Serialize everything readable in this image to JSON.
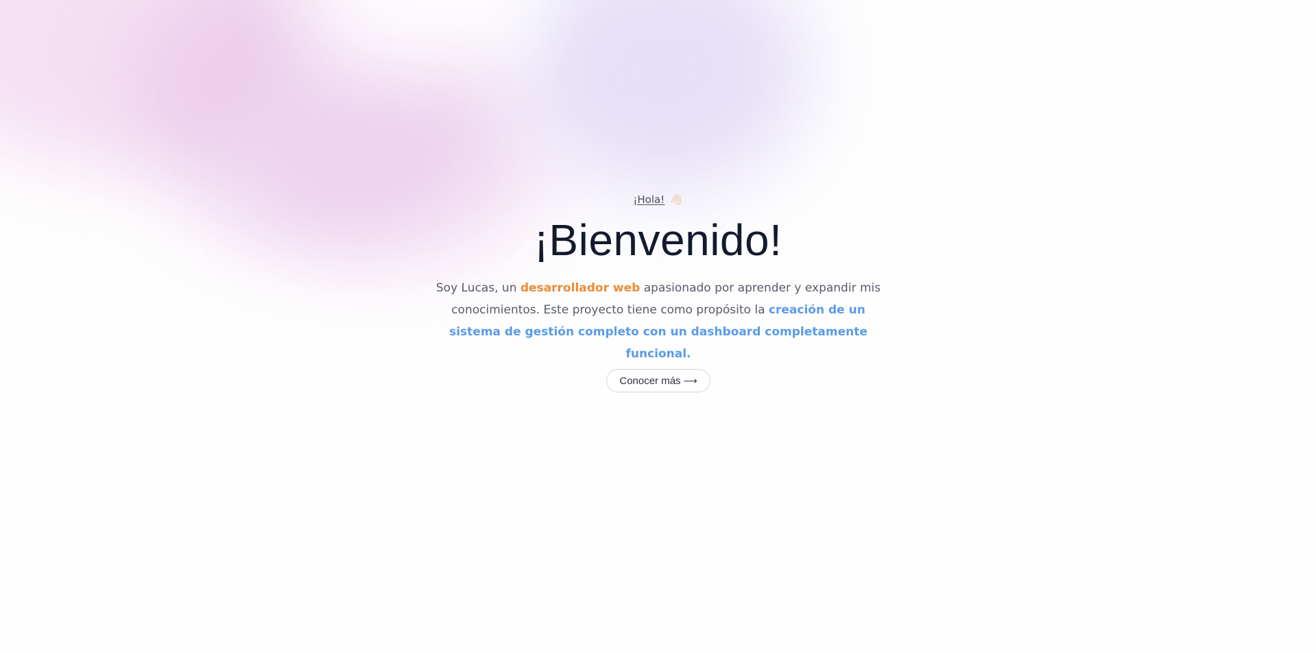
{
  "hero": {
    "greeting": "¡Hola!",
    "wave_icon": "👋🏻",
    "title": "¡Bienvenido!",
    "intro": {
      "part1": "Soy Lucas, un ",
      "highlight1": "desarrollador web",
      "part2": " apasionado por aprender y expandir mis conocimientos. Este proyecto tiene como propósito la ",
      "highlight2": "creación de un sistema de gestión completo con un dashboard completamente funcional."
    },
    "cta_label": "Conocer más",
    "cta_arrow": "⟶"
  },
  "colors": {
    "title": "#141a2e",
    "highlight_orange": "#f08a33",
    "highlight_blue": "#5a9be6",
    "blob_pink": "#ecc4e8",
    "blob_lavender": "#d6caf4"
  }
}
